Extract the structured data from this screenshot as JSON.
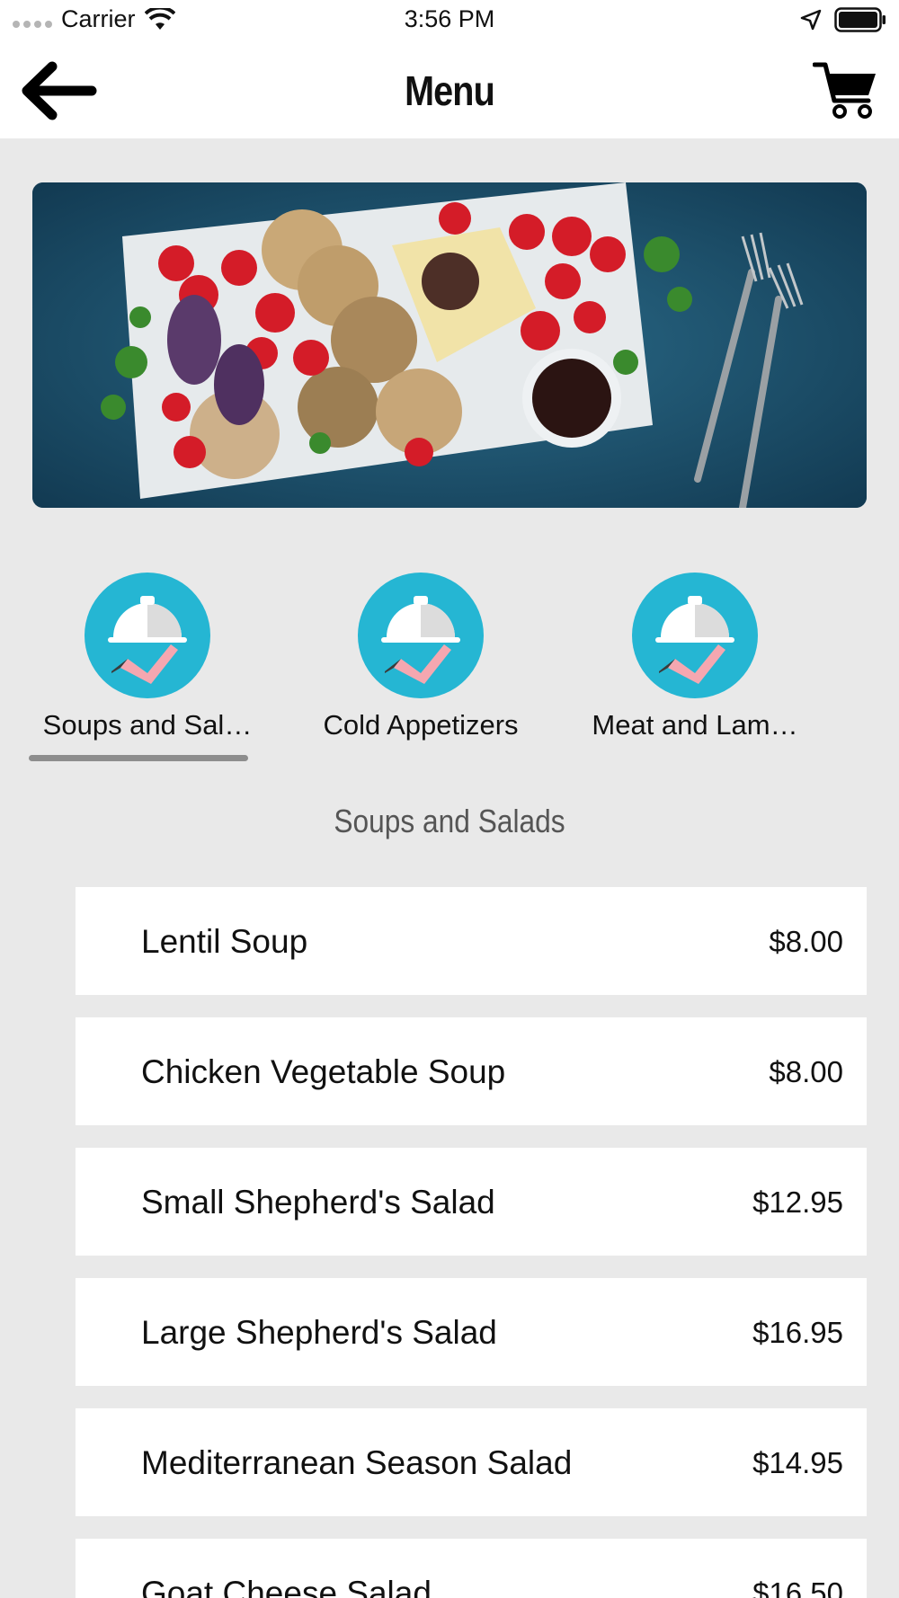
{
  "status_bar": {
    "carrier": "Carrier",
    "time": "3:56 PM"
  },
  "nav": {
    "title": "Menu",
    "back_icon": "arrow-left-icon",
    "cart_icon": "shopping-cart-icon"
  },
  "categories": [
    {
      "label": "Soups and Sal…",
      "icon": "serving-cloche-icon",
      "selected": true
    },
    {
      "label": "Cold Appetizers",
      "icon": "serving-cloche-icon",
      "selected": false
    },
    {
      "label": "Meat and Lam…",
      "icon": "serving-cloche-icon",
      "selected": false
    }
  ],
  "section_title": "Soups and Salads",
  "items": [
    {
      "name": "Lentil Soup",
      "price": "$8.00"
    },
    {
      "name": "Chicken Vegetable Soup",
      "price": "$8.00"
    },
    {
      "name": "Small Shepherd's Salad",
      "price": "$12.95"
    },
    {
      "name": "Large Shepherd's Salad",
      "price": "$16.95"
    },
    {
      "name": "Mediterranean Season Salad",
      "price": "$14.95"
    },
    {
      "name": "Goat Cheese Salad",
      "price": "$16.50"
    }
  ],
  "colors": {
    "accent": "#25b6d3",
    "background": "#e9e9e9"
  }
}
